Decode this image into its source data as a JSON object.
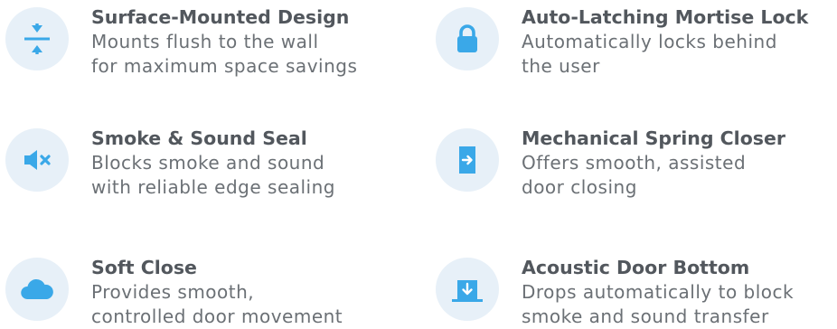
{
  "features": [
    {
      "title": "Surface-Mounted Design",
      "desc_line1": "Mounts flush to the wall",
      "desc_line2": "for maximum space savings",
      "icon": "compress-arrows-icon"
    },
    {
      "title": "Auto-Latching Mortise Lock",
      "desc_line1": "Automatically locks behind",
      "desc_line2": "the user",
      "icon": "lock-icon"
    },
    {
      "title": "Smoke & Sound Seal",
      "desc_line1": "Blocks smoke and sound",
      "desc_line2": "with reliable edge sealing",
      "icon": "speaker-mute-icon"
    },
    {
      "title": "Mechanical Spring Closer",
      "desc_line1": "Offers smooth, assisted",
      "desc_line2": "door closing",
      "icon": "door-arrow-icon"
    },
    {
      "title": "Soft Close",
      "desc_line1": "Provides smooth,",
      "desc_line2": "controlled door movement",
      "icon": "cloud-icon"
    },
    {
      "title": "Acoustic Door Bottom",
      "desc_line1": "Drops automatically to block",
      "desc_line2": "smoke and sound transfer",
      "icon": "down-arrow-box-icon"
    }
  ],
  "colors": {
    "icon_blue": "#3aa8e8",
    "circle_bg": "#e7f0f8",
    "title_text": "#52575d",
    "desc_text": "#6b7075"
  }
}
